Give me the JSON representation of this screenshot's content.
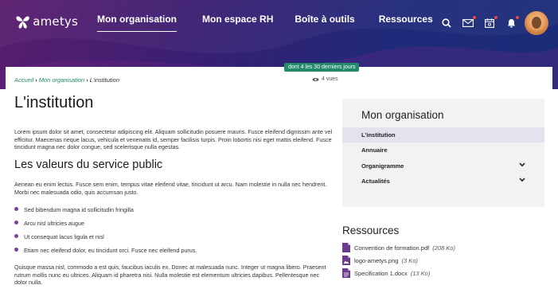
{
  "brand": {
    "name": "ametys"
  },
  "nav": {
    "items": [
      {
        "label": "Mon organisation"
      },
      {
        "label": "Mon espace RH"
      },
      {
        "label": "Boîte à outils"
      },
      {
        "label": "Ressources"
      }
    ]
  },
  "tools": {
    "icons": [
      "search-icon",
      "mail-icon",
      "calendar-icon",
      "bell-icon"
    ]
  },
  "colors": {
    "accent": "#23896a",
    "bullet": "#7e3f9e",
    "notification": "#e84545"
  },
  "badge": {
    "text": "dont 4 les 30 derniers jours"
  },
  "breadcrumb": {
    "home": "Accueil",
    "section": "Mon organisation",
    "current": "L'institution"
  },
  "views": {
    "text": "4 vues"
  },
  "main": {
    "title": "L'institution",
    "intro": "Lorem ipsum dolor sit amet, consectetur adipiscing elit. Aliquam sollicitudin posuere mauris. Fusce eleifend dignissim ante vel efficitur. Maecenas neque lacus, vehicula et venenatis id, semper facilisis turpis. Proin lobortis nisi eget mattis eleifend. Fusce tincidunt magna nec dolor congue, sed scelerisque nulla egestas.",
    "section_title": "Les valeurs du service public",
    "section_text": "Aenean eu enim lectus. Fusce sem enim, tempus vitae eleifend vitae, tincidunt ut arcu. Nam molestie in nulla nec hendrerit. Morbi nec malesuada odio, quis accumsan justo.",
    "bullets": [
      "Sed bibendum magna id sollicitudin fringilla",
      "Arcu nisl ultricies augue",
      "Ut consequat lacus ligula et nisl",
      "Etiam nec eleifend dolor, eu tincidunt orci. Fusce nec eleifend purus."
    ],
    "closing": "Quisque massa nisl, commodo a est quis, faucibus iaculis ex. Donec at malesuada nunc. Integer ut magna libero. Praesent rutrum mollis nunc eu ultrices. Aliquam id pharetra nisi. Nulla molestie est elementum ultricies dapibus. Pellentesque nec dolor nulla."
  },
  "sidebar": {
    "title": "Mon organisation",
    "items": [
      {
        "label": "L'institution"
      },
      {
        "label": "Annuaire"
      },
      {
        "label": "Organigramme"
      },
      {
        "label": "Actualités"
      }
    ]
  },
  "resources": {
    "title": "Ressources",
    "files": [
      {
        "name": "Convention de formation.pdf",
        "size": "(208 Ko)"
      },
      {
        "name": "logo-ametys.png",
        "size": "(3 Ko)"
      },
      {
        "name": "Specification 1.docx",
        "size": "(13 Ko)"
      }
    ]
  }
}
